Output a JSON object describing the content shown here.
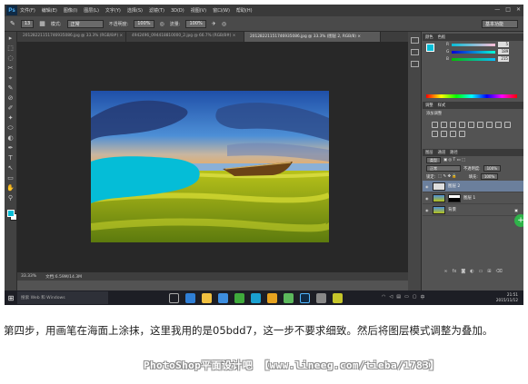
{
  "app": {
    "logo": "Ps",
    "menu": [
      "文件(F)",
      "编辑(E)",
      "图像(I)",
      "图层(L)",
      "文字(Y)",
      "选择(S)",
      "滤镜(T)",
      "3D(D)",
      "视图(V)",
      "窗口(W)",
      "帮助(H)"
    ],
    "window_controls": [
      "—",
      "□",
      "✕"
    ]
  },
  "options_bar": {
    "brush_size": "13",
    "mode_label": "模式:",
    "mode_value": "正常",
    "opacity_label": "不透明度:",
    "opacity_value": "100%",
    "flow_label": "流量:",
    "flow_value": "100%",
    "workspace": "基本功能"
  },
  "tabs": [
    {
      "label": "20128221151746935086.jpg @ 33.3% (RGB/8#) ×"
    },
    {
      "label": "4942496_094418810000_2.jpg @ 66.7% (RGB/8#) ×"
    },
    {
      "label": "20128221151746935086.jpg @ 33.3% (图层 2, RGB/8) ×"
    }
  ],
  "tools": [
    "▸",
    "⬚",
    "◌",
    "✂",
    "⌖",
    "✎",
    "⊘",
    "✐",
    "✦",
    "⬭",
    "◐",
    "✒",
    "T",
    "↖",
    "▭",
    "✋",
    "⚲"
  ],
  "canvas": {
    "paint_color": "#05bdd7"
  },
  "status": {
    "zoom": "33.33%",
    "doc": "文档:6.59M/14.3M"
  },
  "color_panel": {
    "tabs": [
      "颜色",
      "色板"
    ],
    "r": "5",
    "g": "189",
    "b": "215"
  },
  "adjust_panel": {
    "tabs": [
      "调整",
      "样式"
    ],
    "hint": "添加调整"
  },
  "layers_panel": {
    "tabs": [
      "图层",
      "通道",
      "路径"
    ],
    "kind_filter": "类型",
    "blend_mode": "正常",
    "opacity_label": "不透明度:",
    "opacity_value": "100%",
    "lock_label": "锁定:",
    "fill_label": "填充:",
    "fill_value": "100%",
    "layers": [
      {
        "name": "图层 2",
        "selected": true
      },
      {
        "name": "图层 1",
        "selected": false
      },
      {
        "name": "背景",
        "selected": false
      }
    ]
  },
  "taskbar": {
    "search_placeholder": "搜索 Web 和 Windows",
    "time": "21:51",
    "date": "2015/11/12"
  },
  "caption": "第四步，用画笔在海面上涂抹，这里我用的是05bdd7，这一步不要求细致。然后将图层模式调整为叠加。",
  "watermark": "PhotoShop平面设计吧 【www.lineeg.com/tieba/1783】"
}
